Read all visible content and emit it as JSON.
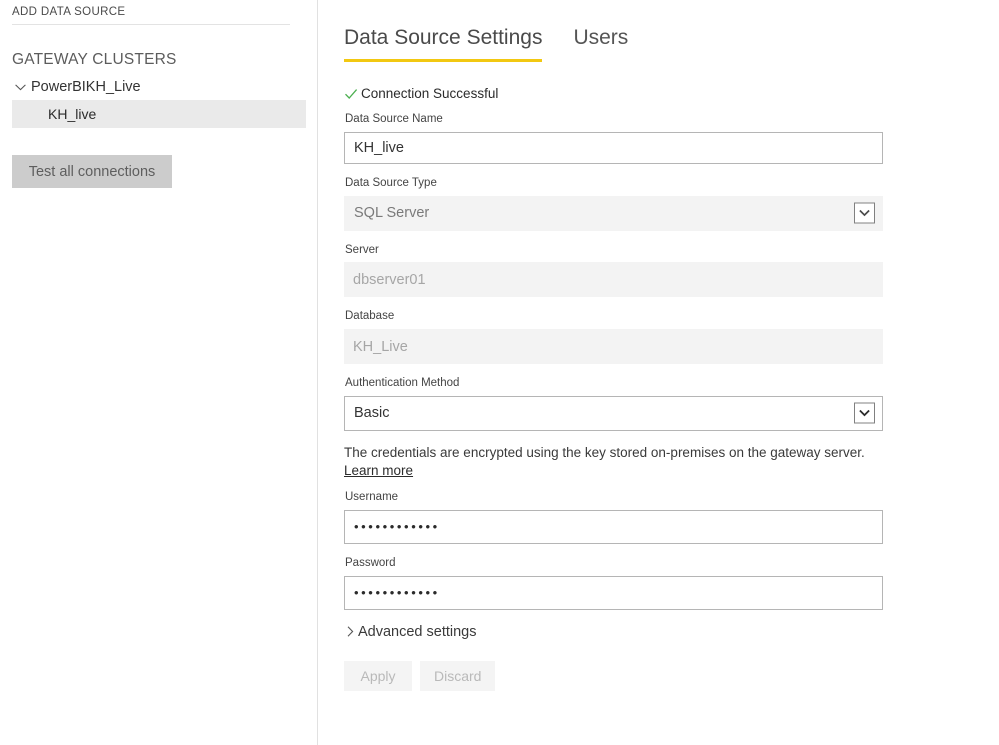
{
  "sidebar": {
    "add_data_source_label": "ADD DATA SOURCE",
    "clusters_heading": "GATEWAY CLUSTERS",
    "cluster": {
      "name": "PowerBIKH_Live",
      "expand_icon": "chevron-down-icon",
      "expanded": true
    },
    "data_sources": [
      {
        "name": "KH_live",
        "selected": true
      }
    ],
    "test_all_connections_label": "Test all connections"
  },
  "main": {
    "tabs": [
      {
        "label": "Data Source Settings",
        "active": true
      },
      {
        "label": "Users",
        "active": false
      }
    ],
    "connection_status": {
      "icon": "check-icon",
      "text": "Connection Successful",
      "color": "#4caf50"
    },
    "form": {
      "data_source_name": {
        "label": "Data Source Name",
        "value": "KH_live"
      },
      "data_source_type": {
        "label": "Data Source Type",
        "value": "SQL Server",
        "icon": "chevron-down-icon"
      },
      "server": {
        "label": "Server",
        "value": "dbserver01"
      },
      "database": {
        "label": "Database",
        "value": "KH_Live"
      },
      "authentication_method": {
        "label": "Authentication Method",
        "value": "Basic",
        "icon": "chevron-down-icon"
      },
      "credentials_note": {
        "text": "The credentials are encrypted using the key stored on-premises on the gateway server.",
        "link_label": "Learn more"
      },
      "username": {
        "label": "Username",
        "value": "••••••••••••"
      },
      "password": {
        "label": "Password",
        "value": "••••••••••••"
      },
      "advanced_settings": {
        "label": "Advanced settings",
        "icon": "chevron-right-icon",
        "expanded": false
      },
      "apply_label": "Apply",
      "discard_label": "Discard"
    }
  },
  "theme": {
    "accent": "#f2c811",
    "success": "#4caf50",
    "selected_row_bg": "#eaeaea",
    "button_bg": "#cccccc"
  }
}
